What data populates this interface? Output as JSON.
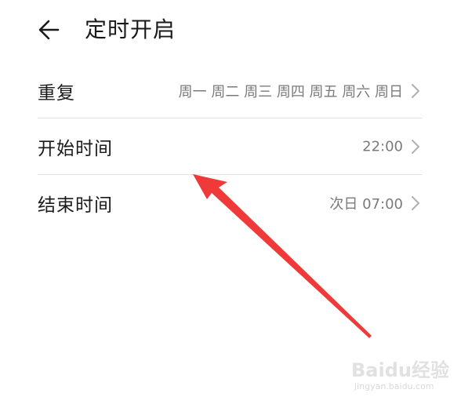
{
  "header": {
    "back_icon": "arrow-left-icon",
    "title": "定时开启"
  },
  "settings": [
    {
      "label": "重复",
      "value": "周一 周二 周三 周四 周五 周六 周日"
    },
    {
      "label": "开始时间",
      "value": "22:00"
    },
    {
      "label": "结束时间",
      "value": "次日 07:00"
    }
  ],
  "annotation": {
    "type": "red-arrow",
    "color": "#f03a3a"
  },
  "watermark": {
    "logo": "Baidu经验",
    "url": "jingyan.baidu.com"
  },
  "colors": {
    "text_primary": "#1a1a1a",
    "text_secondary": "#7a7a7a",
    "divider": "#e3e3e3",
    "chevron": "#b0b0b0"
  }
}
